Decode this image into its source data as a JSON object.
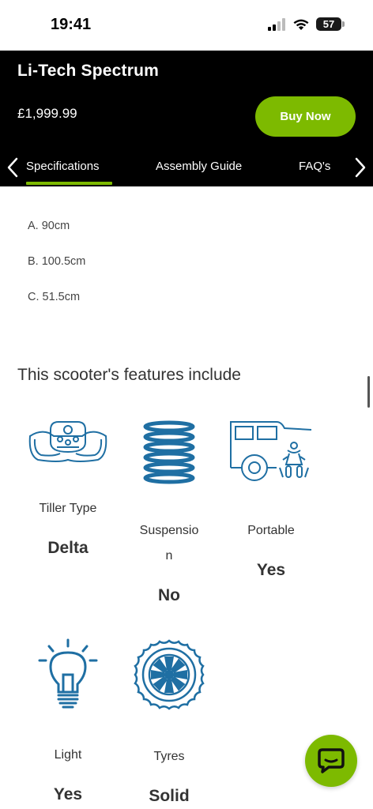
{
  "status_bar": {
    "time": "19:41",
    "battery": "57"
  },
  "header": {
    "title": "Li-Tech Spectrum",
    "price": "£1,999.99",
    "buy_label": "Buy Now"
  },
  "tabs": [
    {
      "label": "Specifications",
      "active": true
    },
    {
      "label": "Assembly Guide",
      "active": false
    },
    {
      "label": "FAQ's",
      "active": false
    }
  ],
  "dimensions": [
    "A. 90cm",
    "B. 100.5cm",
    "C. 51.5cm"
  ],
  "features_heading": "This scooter's features include",
  "features": [
    {
      "label": "Tiller Type",
      "value": "Delta",
      "icon": "tiller-icon"
    },
    {
      "label": "Suspensio\nn",
      "value": "No",
      "icon": "spring-icon"
    },
    {
      "label": "Portable",
      "value": "Yes",
      "icon": "car-scooter-icon"
    },
    {
      "label": "Light",
      "value": "Yes",
      "icon": "lightbulb-icon"
    },
    {
      "label": "Tyres",
      "value": "Solid",
      "icon": "tyre-icon"
    }
  ],
  "colors": {
    "accent": "#7dba00",
    "icon": "#1f6fa3",
    "header_bg": "#000000"
  },
  "chat_icon": "chat-bubble-icon"
}
